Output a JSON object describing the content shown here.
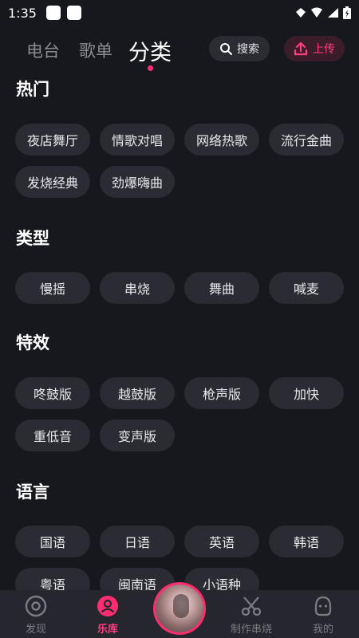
{
  "status": {
    "time": "1:35"
  },
  "header": {
    "tabs": [
      {
        "label": "电台"
      },
      {
        "label": "歌单"
      },
      {
        "label": "分类"
      }
    ],
    "search_label": "搜索",
    "upload_label": "上传"
  },
  "sections": [
    {
      "title": "热门",
      "chips": [
        "夜店舞厅",
        "情歌对唱",
        "网络热歌",
        "流行金曲",
        "发烧经典",
        "劲爆嗨曲"
      ]
    },
    {
      "title": "类型",
      "chips": [
        "慢摇",
        "串烧",
        "舞曲",
        "喊麦"
      ]
    },
    {
      "title": "特效",
      "chips": [
        "咚鼓版",
        "越鼓版",
        "枪声版",
        "加快",
        "重低音",
        "变声版"
      ]
    },
    {
      "title": "语言",
      "chips": [
        "国语",
        "日语",
        "英语",
        "韩语",
        "粤语",
        "闽南语",
        "小语种"
      ]
    }
  ],
  "nav": [
    {
      "label": "发现",
      "icon": "disc-icon"
    },
    {
      "label": "乐库",
      "icon": "music-library-icon"
    },
    {
      "label": "制作串烧",
      "icon": "scissors-icon"
    },
    {
      "label": "我的",
      "icon": "profile-icon"
    }
  ],
  "colors": {
    "accent": "#ff2d6f",
    "background": "#17181d",
    "chip": "#2a2b33"
  }
}
